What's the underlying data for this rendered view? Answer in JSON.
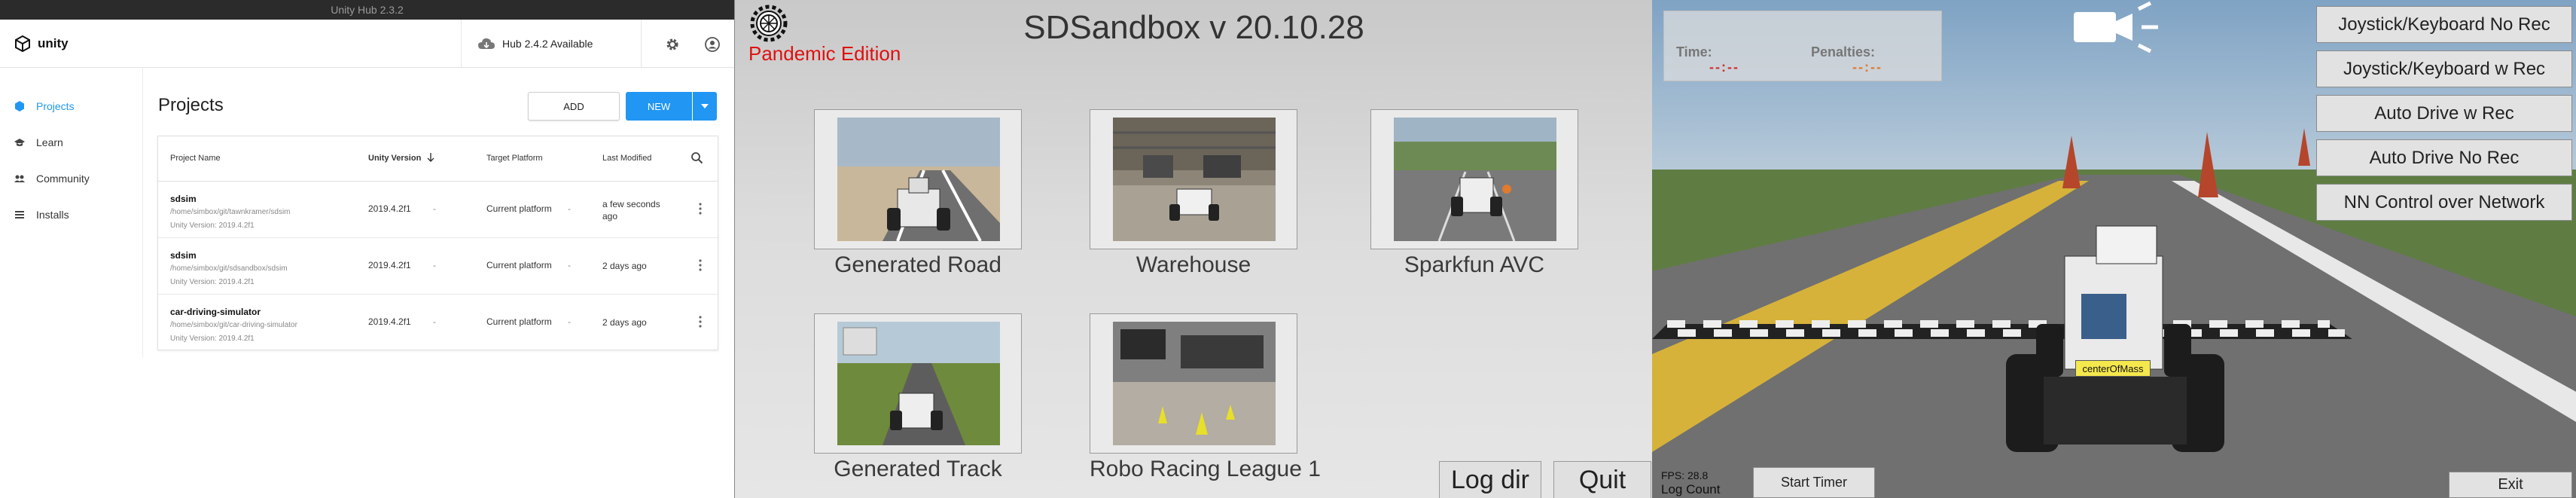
{
  "hub": {
    "window_title": "Unity Hub 2.3.2",
    "logo_text": "unity",
    "update_notice": "Hub 2.4.2 Available",
    "sidebar": [
      {
        "label": "Projects",
        "icon": "cube-icon",
        "active": true
      },
      {
        "label": "Learn",
        "icon": "graduation-cap-icon",
        "active": false
      },
      {
        "label": "Community",
        "icon": "people-icon",
        "active": false
      },
      {
        "label": "Installs",
        "icon": "list-icon",
        "active": false
      }
    ],
    "title": "Projects",
    "add_label": "ADD",
    "new_label": "NEW",
    "columns": {
      "name": "Project Name",
      "version": "Unity Version",
      "platform": "Target Platform",
      "modified": "Last Modified"
    },
    "projects": [
      {
        "name": "sdsim",
        "path": "/home/simbox/git/tawnkramer/sdsim",
        "version_line": "Unity Version: 2019.4.2f1",
        "version": "2019.4.2f1",
        "dash": "-",
        "platform": "Current platform",
        "dash2": "-",
        "modified": "a few seconds ago"
      },
      {
        "name": "sdsim",
        "path": "/home/simbox/git/sdsandbox/sdsim",
        "version_line": "Unity Version: 2019.4.2f1",
        "version": "2019.4.2f1",
        "dash": "-",
        "platform": "Current platform",
        "dash2": "-",
        "modified": "2 days ago"
      },
      {
        "name": "car-driving-simulator",
        "path": "/home/simbox/git/car-driving-simulator",
        "version_line": "Unity Version: 2019.4.2f1",
        "version": "2019.4.2f1",
        "dash": "-",
        "platform": "Current platform",
        "dash2": "-",
        "modified": "2 days ago"
      }
    ],
    "accent_color": "#2196f3"
  },
  "sandbox": {
    "title": "SDSandbox v 20.10.28",
    "subtitle": "Pandemic Edition",
    "scenes": [
      {
        "label": "Generated Road"
      },
      {
        "label": "Warehouse"
      },
      {
        "label": "Sparkfun AVC"
      },
      {
        "label": "Generated Track"
      },
      {
        "label": "Robo Racing League 1"
      }
    ],
    "log_dir_label": "Log dir",
    "quit_label": "Quit",
    "subtitle_color": "#e01010"
  },
  "sim": {
    "time_label": "Time:",
    "time_value": "--:--",
    "penalties_label": "Penalties:",
    "penalties_value": "--:--",
    "buttons": [
      "Joystick/Keyboard No Rec",
      "Joystick/Keyboard w Rec",
      "Auto Drive w Rec",
      "Auto Drive No Rec",
      "NN Control over Network"
    ],
    "fps_text": "FPS: 28.8",
    "log_count_text": "Log Count",
    "start_timer_label": "Start Timer",
    "exit_label": "Exit",
    "center_of_mass_label": "centerOfMass"
  }
}
